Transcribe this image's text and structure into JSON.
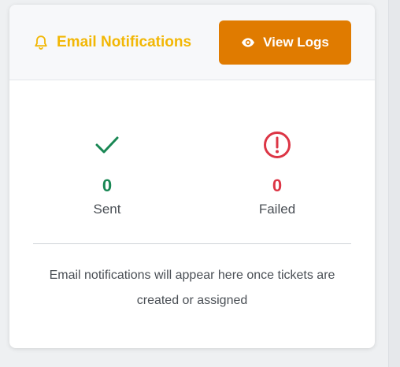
{
  "header": {
    "title": "Email Notifications",
    "view_logs_label": "View Logs",
    "title_color": "#f2b705",
    "button_color": "#e07b00"
  },
  "stats": {
    "sent": {
      "value": "0",
      "label": "Sent",
      "icon": "check-icon",
      "color": "#198754"
    },
    "failed": {
      "value": "0",
      "label": "Failed",
      "icon": "exclamation-circle-icon",
      "color": "#dc3545"
    }
  },
  "empty_message": "Email notifications will appear here once tickets are created or assigned"
}
